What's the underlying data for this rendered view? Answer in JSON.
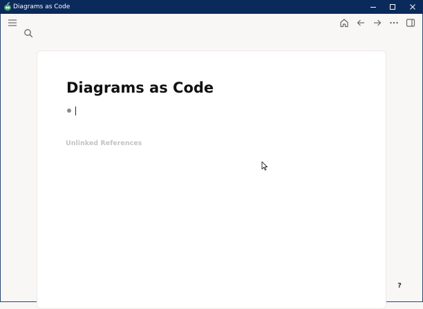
{
  "window": {
    "title": "Diagrams as Code",
    "controls": [
      "minimize-icon",
      "maximize-icon",
      "close-icon"
    ]
  },
  "toolbar": {
    "left_icons": [
      "menu-icon",
      "search-icon"
    ],
    "right_icons": [
      "home-icon",
      "arrow-left-icon",
      "arrow-right-icon",
      "more-icon",
      "sidebar-toggle-icon"
    ]
  },
  "page": {
    "title": "Diagrams as Code",
    "block_text": "",
    "unlinked_references": "Unlinked References"
  },
  "help": {
    "label": "?"
  },
  "colors": {
    "titlebar": "#0b2a5c",
    "background": "#f9f6f6",
    "card": "#ffffff",
    "muted_text": "#c4c4c4"
  }
}
